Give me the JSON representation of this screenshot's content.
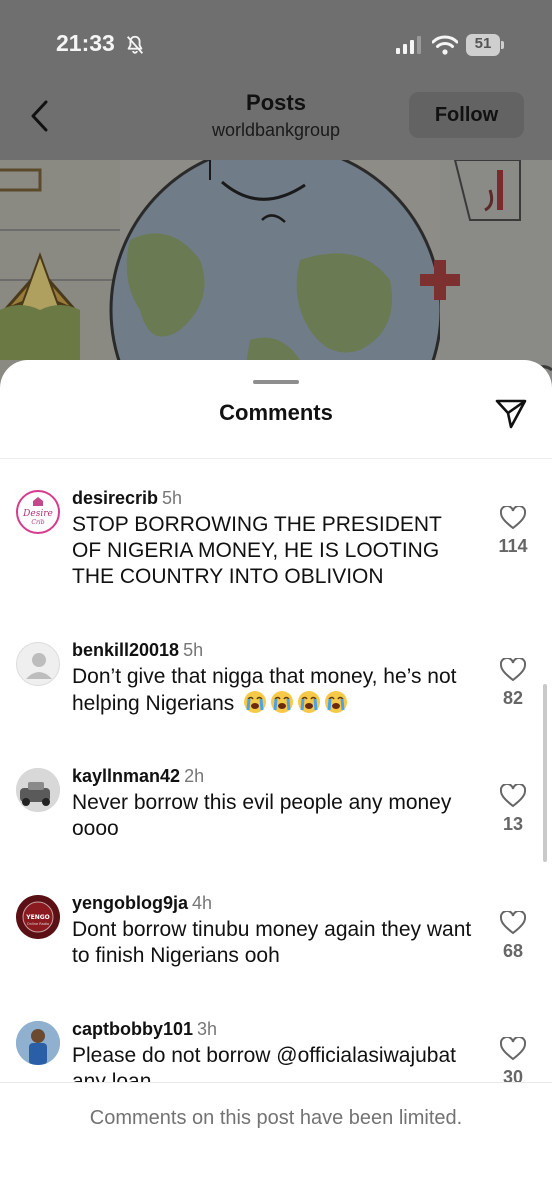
{
  "status_bar": {
    "time": "21:33",
    "battery": "51",
    "icons": [
      "bell-slash-icon",
      "signal-icon",
      "wifi-icon",
      "battery-icon"
    ]
  },
  "header": {
    "title": "Posts",
    "subtitle": "worldbankgroup",
    "follow_label": "Follow",
    "back_icon": "chevron-left-icon"
  },
  "sheet": {
    "title": "Comments",
    "share_icon": "paper-plane-icon"
  },
  "comments": [
    {
      "user": "desirecrib",
      "time": "5h",
      "text": "STOP BORROWING THE PRESIDENT OF NIGERIA MONEY, HE IS LOOTING THE COUNTRY INTO OBLIVION",
      "likes": "114"
    },
    {
      "user": "benkill20018",
      "time": "5h",
      "text": "Don’t give that nigga that money, he’s not helping Nigerians",
      "likes": "82",
      "emoji": "loudly-crying-face x4"
    },
    {
      "user": "kayllnman42",
      "time": "2h",
      "text": "Never borrow this evil people any money oooo",
      "likes": "13"
    },
    {
      "user": "yengoblog9ja",
      "time": "4h",
      "text": "Dont borrow tinubu money again they want to finish Nigerians ooh",
      "likes": "68"
    },
    {
      "user": "captbobby101",
      "time": "3h",
      "text": "Please do not borrow @officialasiwajubat any loan",
      "likes": "30"
    }
  ],
  "avatar_text": {
    "desire": "Desire",
    "crib": "Crib",
    "yengo": "YENGO",
    "yengo_sub": "Online Radio"
  },
  "footer": {
    "text": "Comments on this post have been limited."
  },
  "colors": {
    "overlay": "#6f6f6f",
    "sheet": "#ffffff",
    "secondary_text": "#737373"
  }
}
